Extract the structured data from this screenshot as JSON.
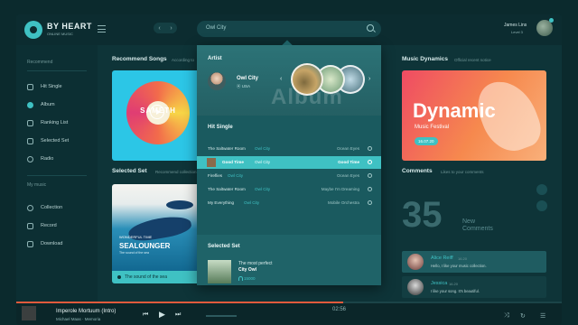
{
  "app": {
    "title": "BY HEART",
    "subtitle": "ONLINE MUSIC"
  },
  "header": {
    "search_value": "Owl City",
    "user_name": "James Lins",
    "user_sub": "Level 3"
  },
  "sidebar": {
    "head1": "Recommend",
    "items1": [
      {
        "label": "Hit Single",
        "icon": "music-note-icon"
      },
      {
        "label": "Album",
        "icon": "disc-icon",
        "active": true
      },
      {
        "label": "Ranking List",
        "icon": "list-icon"
      },
      {
        "label": "Selected Set",
        "icon": "star-icon"
      },
      {
        "label": "Radio",
        "icon": "headphones-icon"
      }
    ],
    "head2": "My music",
    "items2": [
      {
        "label": "Collection",
        "icon": "collection-icon"
      },
      {
        "label": "Record",
        "icon": "record-icon"
      },
      {
        "label": "Download",
        "icon": "download-icon"
      }
    ]
  },
  "main": {
    "recommend_title": "Recommend Songs",
    "recommend_sub": "According to",
    "recommend_card_text": "SAMETH",
    "selected_title": "Selected Set",
    "selected_sub": "Recommend collection",
    "selected_card": {
      "small": "WONDERFUL TIME",
      "big": "SEALOUNGER",
      "sub": "The sound of the sea",
      "foot": "The sound of the sea"
    }
  },
  "dropdown": {
    "artist_heading": "Artist",
    "artist_name": "Owl City",
    "artist_country": "USA",
    "album_word": "Album",
    "hit_heading": "Hit Single",
    "hits": [
      {
        "song": "The Saltwater Room",
        "artist": "Owl City",
        "album": "Ocean Eyes"
      },
      {
        "song": "Good Time",
        "artist": "Owl City",
        "album": "Good Time",
        "active": true
      },
      {
        "song": "Fireflies",
        "artist": "Owl City",
        "album": "Ocean Eyes"
      },
      {
        "song": "The Saltwater Room",
        "artist": "Owl City",
        "album": "Maybe I'm Dreaming"
      },
      {
        "song": "My Everything",
        "artist": "Owl City",
        "album": "Mobile Orchestra"
      }
    ],
    "set_heading": "Selected Set",
    "set_title": "The most perfect",
    "set_title2": "City Owl",
    "set_plays": "15000"
  },
  "right": {
    "dynamics_title": "Music Dynamics",
    "dynamics_sub": "Official recent notice",
    "dyn_card_title": "Dynamic",
    "dyn_card_sub": "Music Festival",
    "dyn_card_date": "16.07.20",
    "comments_title": "Comments",
    "comments_sub": "Likes to your comments",
    "count": "35",
    "count_label_1": "New",
    "count_label_2": "Comments",
    "comments": [
      {
        "name": "Alice Reiff",
        "time": "16.20",
        "text": "Hello, I like your music collection."
      },
      {
        "name": "Jessica",
        "time": "16.20",
        "text": "I like your song. It's beautiful."
      }
    ]
  },
  "player": {
    "title": "Imperole Mortuum (Intro)",
    "artist": "Michael Maas · Memoria",
    "time": "02:56",
    "progress": 0.6
  },
  "colors": {
    "accent": "#3fc1c3",
    "progress": "#e05a3c"
  }
}
